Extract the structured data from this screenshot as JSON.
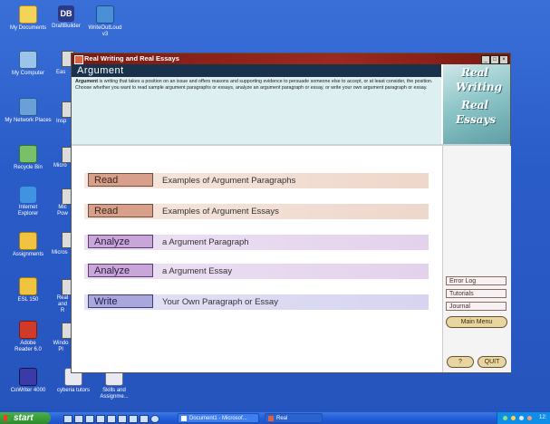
{
  "desktop": {
    "icons": [
      {
        "label": "My Documents",
        "icon": "my-documents-icon"
      },
      {
        "label": "DraftBuilder",
        "icon": "draftbuilder-icon",
        "glyph": "DB"
      },
      {
        "label": "WriteOutLoud v3",
        "icon": "writeoutloud-icon"
      },
      {
        "label": "My Computer",
        "icon": "my-computer-icon"
      },
      {
        "label": "Eas",
        "icon": "easy-icon"
      },
      {
        "label": "My Network Places",
        "icon": "network-places-icon"
      },
      {
        "label": "Insp",
        "icon": "inspiration-icon"
      },
      {
        "label": "Recycle Bin",
        "icon": "recycle-bin-icon"
      },
      {
        "label": "Micro",
        "icon": "microsoft-icon"
      },
      {
        "label": "Internet Explorer",
        "icon": "internet-explorer-icon"
      },
      {
        "label": "Mic Pow",
        "icon": "powerpoint-icon"
      },
      {
        "label": "Assignments",
        "icon": "assignments-folder-icon"
      },
      {
        "label": "Micros",
        "icon": "microsoft-2-icon"
      },
      {
        "label": "ESL 150",
        "icon": "esl-folder-icon"
      },
      {
        "label": "Real and R",
        "icon": "real-essays-icon"
      },
      {
        "label": "Adobe Reader 6.0",
        "icon": "adobe-reader-icon"
      },
      {
        "label": "Windo Pl",
        "icon": "windows-media-icon"
      },
      {
        "label": "CoWriter 4000",
        "icon": "cowriter-icon"
      },
      {
        "label": "cyberia tutors",
        "icon": "cyberia-tutors-icon"
      },
      {
        "label": "Skills and Assignme...",
        "icon": "skills-icon"
      }
    ]
  },
  "window": {
    "title": "Real Writing and Real Essays",
    "controls": {
      "min": "_",
      "max": "□",
      "close": "×"
    },
    "header": "Argument",
    "description_lead": "Argument",
    "description_rest": " is writing that takes a position on an issue and offers reasons and supporting evidence to persuade someone else to accept, or at least consider, the position. Choose whether you want to read sample argument paragraphs or essays, analyze an argument paragraph or essay, or write your own argument paragraph or essay.",
    "brand": [
      "Real",
      "Writing",
      "Real",
      "Essays"
    ]
  },
  "options": [
    {
      "verb": "Read",
      "text": "Examples of Argument Paragraphs"
    },
    {
      "verb": "Read",
      "text": "Examples of Argument Essays"
    },
    {
      "verb": "Analyze",
      "text": "a Argument Paragraph"
    },
    {
      "verb": "Analyze",
      "text": "a Argument Essay"
    },
    {
      "verb": "Write",
      "text": "Your Own Paragraph or Essay"
    }
  ],
  "sidebar": {
    "error_log": "Error Log",
    "tutorials": "Tutorials",
    "journal": "Journal",
    "main_menu": "Main Menu",
    "help": "?",
    "quit": "QUIT"
  },
  "taskbar": {
    "start": "start",
    "tasks": [
      {
        "label": "Document1 - Microsof..."
      },
      {
        "label": "Real"
      }
    ],
    "clock": "12:"
  },
  "colors": {
    "desktop": "#2a5cc8",
    "title_bar": "#9b2a1e",
    "header_strip": "#17324a",
    "read_accent": "#d8a08b",
    "analyze_accent": "#c9a6d9",
    "write_accent": "#a9a7dc"
  }
}
